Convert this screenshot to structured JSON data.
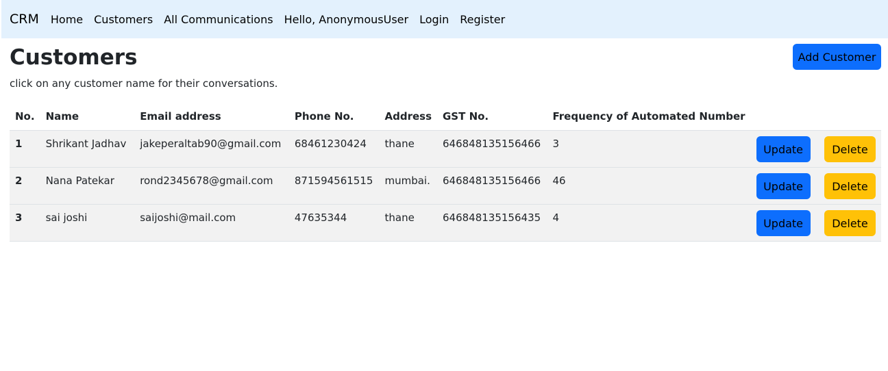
{
  "nav": {
    "brand": "CRM",
    "links": [
      "Home",
      "Customers",
      "All Communications",
      "Hello, AnonymousUser",
      "Login",
      "Register"
    ]
  },
  "page": {
    "title": "Customers",
    "subtitle": "click on any customer name for their conversations.",
    "add_button": "Add Customer"
  },
  "table": {
    "headers": [
      "No.",
      "Name",
      "Email address",
      "Phone No.",
      "Address",
      "GST No.",
      "Frequency of Automated Number"
    ],
    "rows": [
      {
        "no": "1",
        "name": "Shrikant Jadhav",
        "email": "jakeperaltab90@gmail.com",
        "phone": "68461230424",
        "address": "thane",
        "gst": "646848135156466",
        "frequency": "3"
      },
      {
        "no": "2",
        "name": "Nana Patekar",
        "email": "rond2345678@gmail.com",
        "phone": "871594561515",
        "address": "mumbai.",
        "gst": "646848135156466",
        "frequency": "46"
      },
      {
        "no": "3",
        "name": "sai joshi",
        "email": "saijoshi@mail.com",
        "phone": "47635344",
        "address": "thane",
        "gst": "646848135156435",
        "frequency": "4"
      }
    ],
    "update_label": "Update",
    "delete_label": "Delete"
  },
  "colors": {
    "navbar_bg": "#e3f1fd",
    "primary": "#0d6efd",
    "warning": "#ffc107",
    "row_bg": "#f2f2f2"
  }
}
